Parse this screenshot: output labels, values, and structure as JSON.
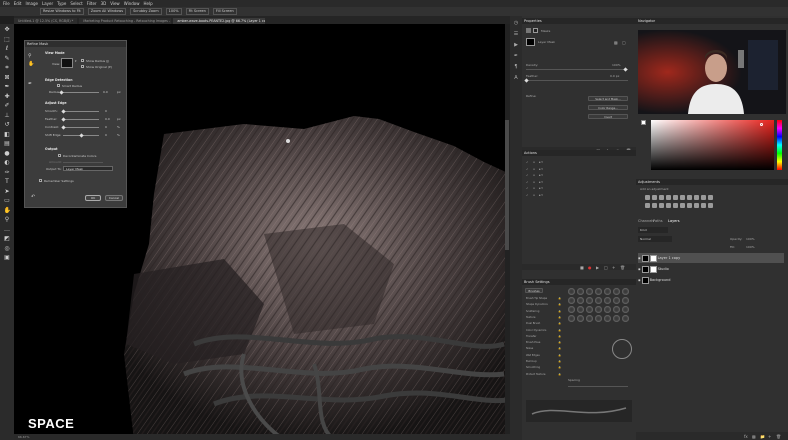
{
  "menubar": {
    "items": [
      "File",
      "Edit",
      "Image",
      "Layer",
      "Type",
      "Select",
      "Filter",
      "3D",
      "View",
      "Window",
      "Help"
    ]
  },
  "options": {
    "items": [
      "Resize Windows to Fit",
      "Zoom All Windows",
      "Scrubby Zoom",
      "100%",
      "Fit Screen",
      "Fill Screen"
    ]
  },
  "doc_tabs": [
    {
      "label": "Untitled-1 @ 12.5% (CS, RGB/8) *"
    },
    {
      "label": "Marketing Product Retouching - Retouching Images - Stibbe-studio.psd @ 16.7% (CS, RGB/8) *"
    },
    {
      "label": "amber-wave-boots-PEANTE2.jpg @ 66.7% (Layer 1 copy, Layer Mask/8) *",
      "active": true
    }
  ],
  "tools": [
    "move-icon",
    "marquee-icon",
    "lasso-icon",
    "quick-select-icon",
    "crop-icon",
    "frame-icon",
    "eyedropper-icon",
    "healing-icon",
    "brush-icon",
    "stamp-icon",
    "history-brush-icon",
    "eraser-icon",
    "gradient-icon",
    "blur-icon",
    "dodge-icon",
    "pen-icon",
    "type-icon",
    "path-select-icon",
    "rectangle-icon",
    "hand-icon",
    "zoom-icon",
    "more-icon",
    "colors-icon",
    "quickmask-icon",
    "screenmode-icon"
  ],
  "refine_mask": {
    "title": "Refine Mask",
    "view_mode": {
      "heading": "View Mode",
      "view_label": "View:",
      "show_radius": "Show Radius (J)",
      "show_original": "Show Original (P)"
    },
    "edge_detection": {
      "heading": "Edge Detection",
      "smart_radius": "Smart Radius",
      "radius_label": "Radius:",
      "radius_value": "0.0",
      "radius_unit": "px"
    },
    "adjust_edge": {
      "heading": "Adjust Edge",
      "rows": [
        {
          "label": "Smooth:",
          "value": "0",
          "unit": "",
          "fill": 0.0
        },
        {
          "label": "Feather:",
          "value": "0.0",
          "unit": "px",
          "fill": 0.0
        },
        {
          "label": "Contrast:",
          "value": "0",
          "unit": "%",
          "fill": 0.0
        },
        {
          "label": "Shift Edge:",
          "value": "0",
          "unit": "%",
          "fill": 0.5
        }
      ]
    },
    "output": {
      "heading": "Output",
      "decontaminate": "Decontaminate Colors",
      "amount_label": "Amount:",
      "output_to_label": "Output To:",
      "output_to_value": "Layer Mask"
    },
    "remember": "Remember Settings",
    "ok": "OK",
    "cancel": "Cancel"
  },
  "overlay_text": "SPACE",
  "properties": {
    "title": "Properties",
    "masks_label": "Masks",
    "layer_mask_label": "Layer Mask",
    "density_label": "Density:",
    "density_value": "100%",
    "feather_label": "Feather:",
    "feather_value": "0.0 px",
    "refine_label": "Refine:",
    "buttons": [
      "Select and Mask...",
      "Color Range...",
      "Invert"
    ]
  },
  "actions": {
    "title": "Actions",
    "rows": [
      "",
      "",
      "",
      "",
      "",
      ""
    ]
  },
  "brush_settings": {
    "title": "Brush Settings",
    "brushes_label": "Brushes",
    "options": [
      "Brush Tip Shape",
      "Shape Dynamics",
      "Scattering",
      "Texture",
      "Dual Brush",
      "Color Dynamics",
      "Transfer",
      "Brush Pose",
      "Noise",
      "Wet Edges",
      "Build-up",
      "Smoothing",
      "Protect Texture"
    ],
    "spacing_label": "Spacing"
  },
  "navigator": {
    "title": "Navigator"
  },
  "adjustments": {
    "title": "Adjustments",
    "subtitle": "Add an adjustment"
  },
  "layers_panel": {
    "tabs": [
      "Channels",
      "Paths",
      "Layers"
    ],
    "kind_label": "Kind",
    "blend_mode": "Normal",
    "opacity_label": "Opacity:",
    "opacity_value": "100%",
    "fill_label": "Fill:",
    "fill_value": "100%",
    "layers": [
      {
        "name": "Layer 1 copy",
        "selected": true
      },
      {
        "name": "Studio",
        "selected": false
      },
      {
        "name": "Background",
        "selected": false
      }
    ]
  },
  "status": {
    "zoom": "66.67%",
    "info": ""
  },
  "colors": {
    "accent": "#e8231d",
    "panel": "#303030",
    "canvas": "#000000"
  }
}
